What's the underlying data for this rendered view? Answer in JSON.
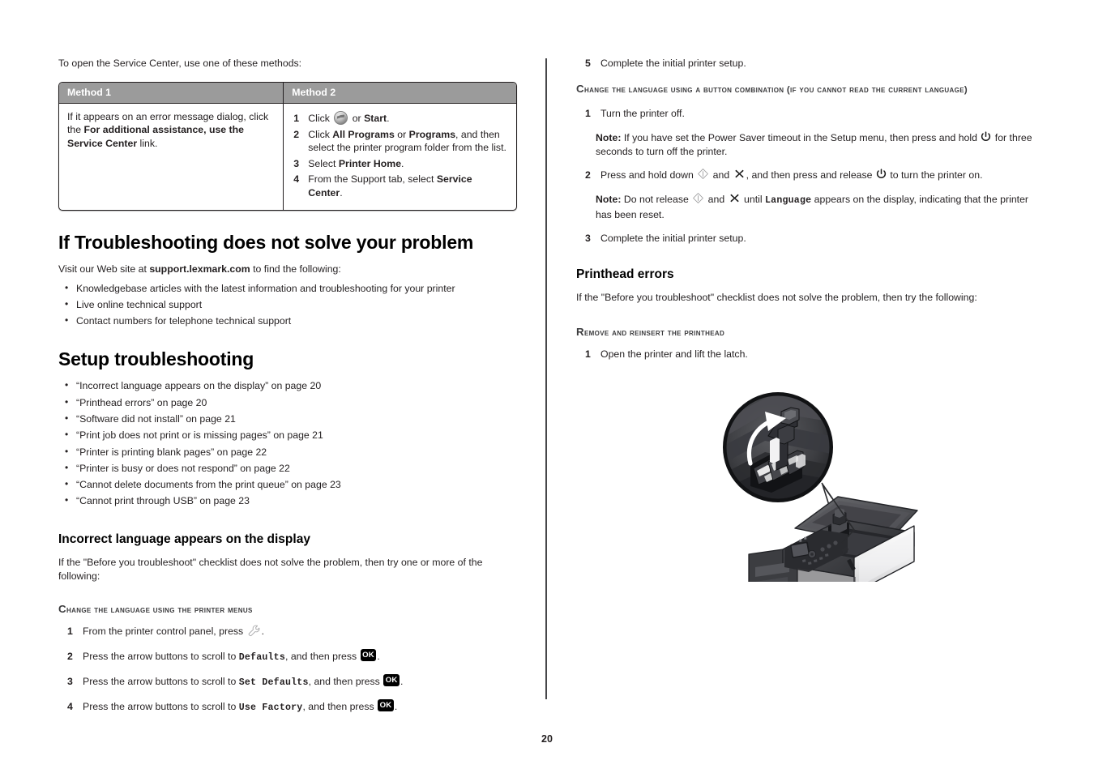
{
  "document": {
    "page_number": "20"
  },
  "left_column": {
    "intro_text": "To open the Service Center, use one of these methods:",
    "methods_table": {
      "headers": [
        "Method 1",
        "Method 2"
      ],
      "method1": {
        "text_part1": "If it appears on an error message dialog, click the ",
        "bold_link": "For additional assistance, use the Service Center",
        "text_part2": " link."
      },
      "method2_steps": [
        {
          "num": "1",
          "pre": "Click ",
          "icon": "windows-start-orb-icon",
          "mid": " or ",
          "bold": "Start",
          "post": "."
        },
        {
          "num": "2",
          "pre": "Click ",
          "bold": "All Programs",
          "mid": " or ",
          "bold2": "Programs",
          "post": ", and then select the printer program folder from the list."
        },
        {
          "num": "3",
          "pre": "Select ",
          "bold": "Printer Home",
          "post": "."
        },
        {
          "num": "4",
          "pre": "From the Support tab, select ",
          "bold": "Service Center",
          "post": "."
        }
      ]
    },
    "section_troubleshooting": {
      "heading": "If Troubleshooting does not solve your problem",
      "intro_pre": "Visit our Web site at ",
      "intro_bold": "support.lexmark.com",
      "intro_post": " to find the following:",
      "bullets": [
        "Knowledgebase articles with the latest information and troubleshooting for your printer",
        "Live online technical support",
        "Contact numbers for telephone technical support"
      ]
    },
    "section_setup": {
      "heading": "Setup troubleshooting",
      "bullets": [
        "“Incorrect language appears on the display” on page 20",
        "“Printhead errors” on page 20",
        "“Software did not install” on page 21",
        "“Print job does not print or is missing pages” on page 21",
        "“Printer is printing blank pages” on page 22",
        "“Printer is busy or does not respond” on page 22",
        "“Cannot delete documents from the print queue” on page 23",
        "“Cannot print through USB” on page 23"
      ]
    },
    "section_incorrect_language": {
      "heading": "Incorrect language appears on the display",
      "intro": "If the \"Before you troubleshoot\" checklist does not solve the problem, then try one or more of the following:",
      "subheading_cap": "C",
      "subheading_rest": "hange the language using the printer menus",
      "steps": [
        {
          "num": "1",
          "pre": "From the printer control panel, press ",
          "icon": "wrench-icon",
          "post": "."
        },
        {
          "num": "2",
          "pre": "Press the arrow buttons to scroll to ",
          "mono": "Defaults",
          "mid": ", and then press ",
          "icon": "ok-key-icon",
          "post": "."
        },
        {
          "num": "3",
          "pre": "Press the arrow buttons to scroll to ",
          "mono": "Set Defaults",
          "mid": ", and then press ",
          "icon": "ok-key-icon",
          "post": "."
        },
        {
          "num": "4",
          "pre": "Press the arrow buttons to scroll to ",
          "mono": "Use Factory",
          "mid": ", and then press ",
          "icon": "ok-key-icon",
          "post": "."
        }
      ]
    }
  },
  "right_column": {
    "step5": {
      "num": "5",
      "text": "Complete the initial printer setup."
    },
    "subheading_button_combo": {
      "cap": "C",
      "rest": "hange the language using a button combination (if you cannot read the current language)"
    },
    "button_combo_steps": [
      {
        "num": "1",
        "text": "Turn the printer off."
      }
    ],
    "note1": {
      "label": "Note:",
      "pre": " If you have set the Power Saver timeout in the Setup menu, then press and hold ",
      "icon": "power-icon",
      "post": " for three seconds to turn off the printer."
    },
    "step2": {
      "num": "2",
      "pre": "Press and hold down ",
      "icon1": "start-diamond-icon",
      "mid1": " and ",
      "icon2": "cancel-x-icon",
      "mid2": ", and then press and release ",
      "icon3": "power-icon",
      "post": " to turn the printer on."
    },
    "note2": {
      "label": "Note:",
      "pre": " Do not release ",
      "icon1": "start-diamond-icon",
      "mid1": " and ",
      "icon2": "cancel-x-icon",
      "mid2": " until ",
      "mono": "Language",
      "post": " appears on the display, indicating that the printer has been reset."
    },
    "step3": {
      "num": "3",
      "text": "Complete the initial printer setup."
    },
    "section_printhead": {
      "heading": "Printhead errors",
      "intro": "If the \"Before you troubleshoot\" checklist does not solve the problem, then try the following:",
      "subheading_cap": "R",
      "subheading_rest": "emove and reinsert the printhead",
      "steps": [
        {
          "num": "1",
          "text": "Open the printer and lift the latch."
        }
      ],
      "illustration_name": "printer-open-lid-printhead-latch-illustration"
    }
  },
  "colors": {
    "table_header_bg": "#9b9b9b",
    "table_header_text": "#ffffff",
    "body_text": "#231f20",
    "subheading_text": "#3a3a3c",
    "divider": "#47474a",
    "key_black": "#000000"
  }
}
